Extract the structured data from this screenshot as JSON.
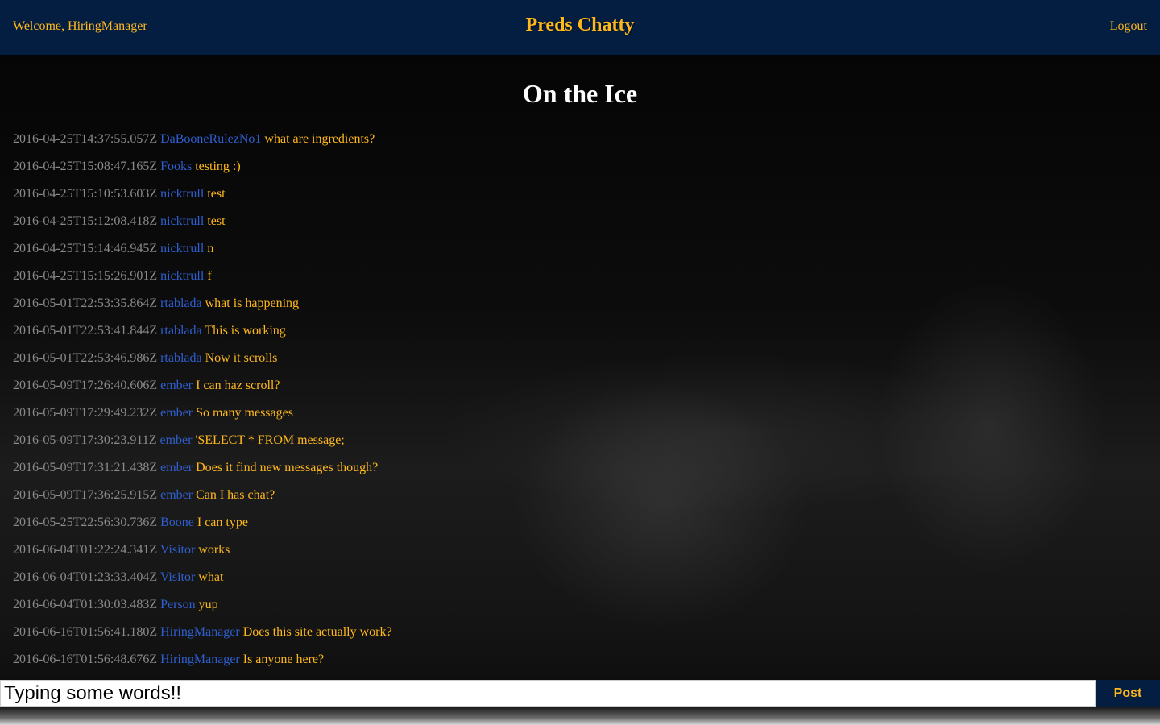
{
  "header": {
    "welcome": "Welcome, HiringManager",
    "brand": "Preds Chatty",
    "logout": "Logout"
  },
  "room": {
    "title": "On the Ice"
  },
  "messages": [
    {
      "timestamp": "2016-04-25T14:37:55.057Z",
      "user": "DaBooneRulezNo1",
      "text": "what are ingredients?"
    },
    {
      "timestamp": "2016-04-25T15:08:47.165Z",
      "user": "Fooks",
      "text": "testing :)"
    },
    {
      "timestamp": "2016-04-25T15:10:53.603Z",
      "user": "nicktrull",
      "text": "test"
    },
    {
      "timestamp": "2016-04-25T15:12:08.418Z",
      "user": "nicktrull",
      "text": "test"
    },
    {
      "timestamp": "2016-04-25T15:14:46.945Z",
      "user": "nicktrull",
      "text": "n"
    },
    {
      "timestamp": "2016-04-25T15:15:26.901Z",
      "user": "nicktrull",
      "text": "f"
    },
    {
      "timestamp": "2016-05-01T22:53:35.864Z",
      "user": "rtablada",
      "text": "what is happening"
    },
    {
      "timestamp": "2016-05-01T22:53:41.844Z",
      "user": "rtablada",
      "text": "This is working"
    },
    {
      "timestamp": "2016-05-01T22:53:46.986Z",
      "user": "rtablada",
      "text": "Now it scrolls"
    },
    {
      "timestamp": "2016-05-09T17:26:40.606Z",
      "user": "ember",
      "text": "I can haz scroll?"
    },
    {
      "timestamp": "2016-05-09T17:29:49.232Z",
      "user": "ember",
      "text": "So many messages"
    },
    {
      "timestamp": "2016-05-09T17:30:23.911Z",
      "user": "ember",
      "text": "'SELECT * FROM message;"
    },
    {
      "timestamp": "2016-05-09T17:31:21.438Z",
      "user": "ember",
      "text": "Does it find new messages though?"
    },
    {
      "timestamp": "2016-05-09T17:36:25.915Z",
      "user": "ember",
      "text": "Can I has chat?"
    },
    {
      "timestamp": "2016-05-25T22:56:30.736Z",
      "user": "Boone",
      "text": "I can type"
    },
    {
      "timestamp": "2016-06-04T01:22:24.341Z",
      "user": "Visitor",
      "text": "works"
    },
    {
      "timestamp": "2016-06-04T01:23:33.404Z",
      "user": "Visitor",
      "text": "what"
    },
    {
      "timestamp": "2016-06-04T01:30:03.483Z",
      "user": "Person",
      "text": "yup"
    },
    {
      "timestamp": "2016-06-16T01:56:41.180Z",
      "user": "HiringManager",
      "text": "Does this site actually work?"
    },
    {
      "timestamp": "2016-06-16T01:56:48.676Z",
      "user": "HiringManager",
      "text": "Is anyone here?"
    }
  ],
  "composer": {
    "value": "Typing some words!!",
    "post_label": "Post"
  },
  "colors": {
    "header_bg": "#041e42",
    "accent_gold": "#ffb81c",
    "username_blue": "#2f5fd0",
    "timestamp_gray": "#8a8a8a"
  }
}
